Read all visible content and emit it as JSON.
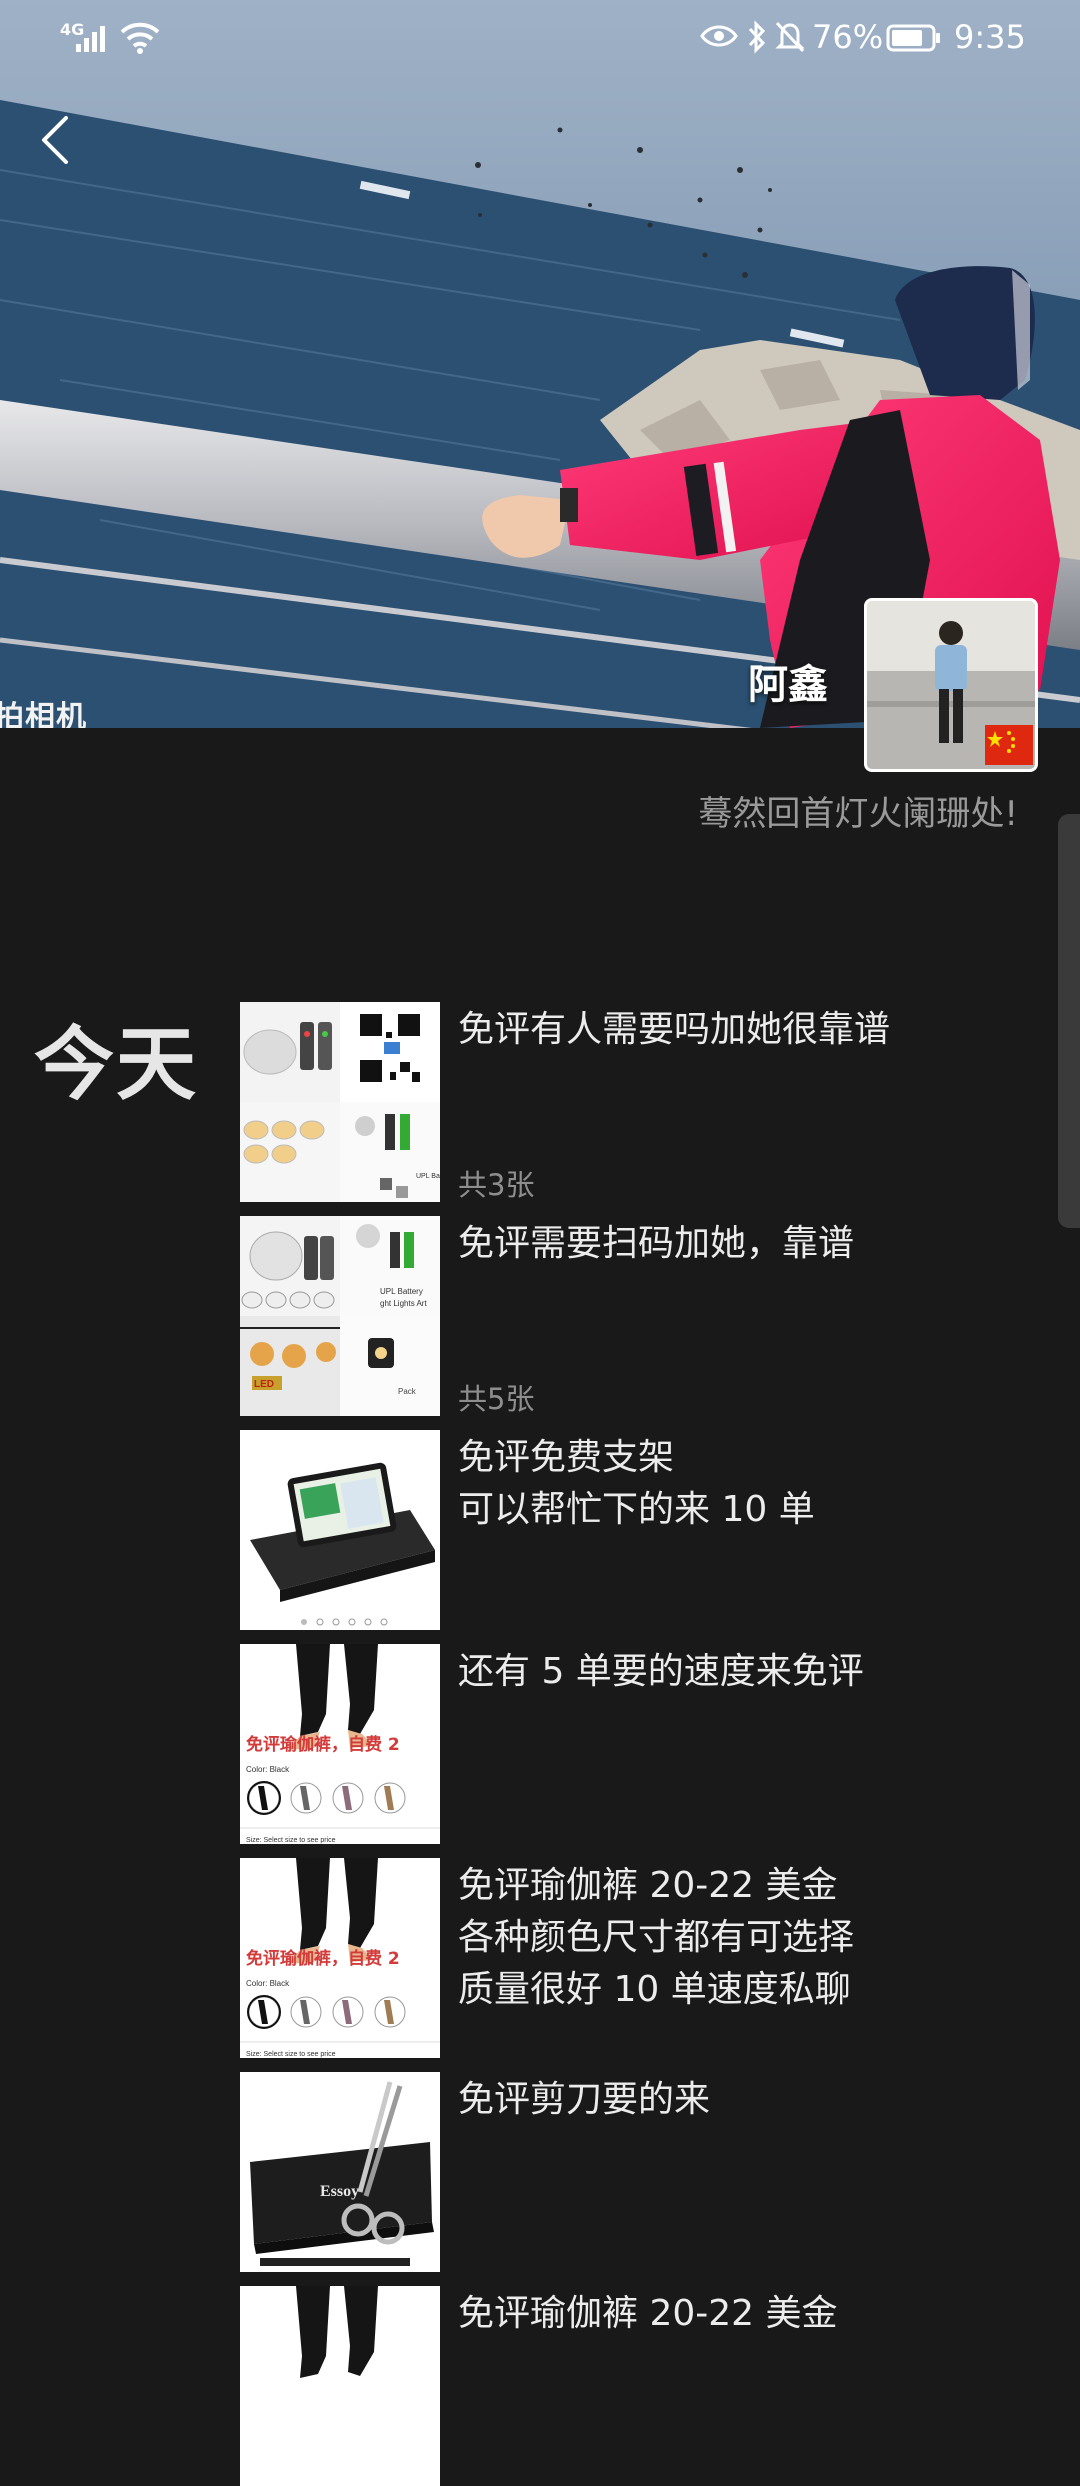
{
  "status_bar": {
    "network": "4G",
    "battery": "76%",
    "time": "9:35",
    "icons": [
      "signal-icon",
      "wifi-icon",
      "eye-icon",
      "bluetooth-icon",
      "mute-bell-icon",
      "battery-icon"
    ]
  },
  "header": {
    "back_icon": "chevron-left-icon"
  },
  "profile": {
    "name": "阿鑫",
    "signature": "蓦然回首灯火阑珊处!",
    "cover_watermark": "拍相机",
    "badge": "china-flag-icon"
  },
  "feed": {
    "day": "今天",
    "posts": [
      {
        "text": "免评有人需要吗加她很靠谱",
        "count": "共3张"
      },
      {
        "text": "免评需要扫码加她，靠谱",
        "count": "共5张"
      },
      {
        "text": "免评免费支架\n可以帮忙下的来 10 单",
        "count": ""
      },
      {
        "text": "还有 5 单要的速度来免评",
        "count": ""
      },
      {
        "text": "免评瑜伽裤 20-22 美金\n各种颜色尺寸都有可选择\n质量很好 10 单速度私聊",
        "count": ""
      },
      {
        "text": "免评剪刀要的来",
        "count": ""
      },
      {
        "text": "免评瑜伽裤 20-22 美金",
        "count": ""
      }
    ],
    "thumb_labels": {
      "yoga_overlay": "免评瑜伽裤，自费 2",
      "color_label": "Color: Black",
      "size_label": "Size: Select size to see price",
      "brand": "Essoy",
      "battery_label": "UPL Battery",
      "lights_label": "ght Lights Art",
      "led_label": "LED",
      "pack_label": "Pack"
    }
  }
}
